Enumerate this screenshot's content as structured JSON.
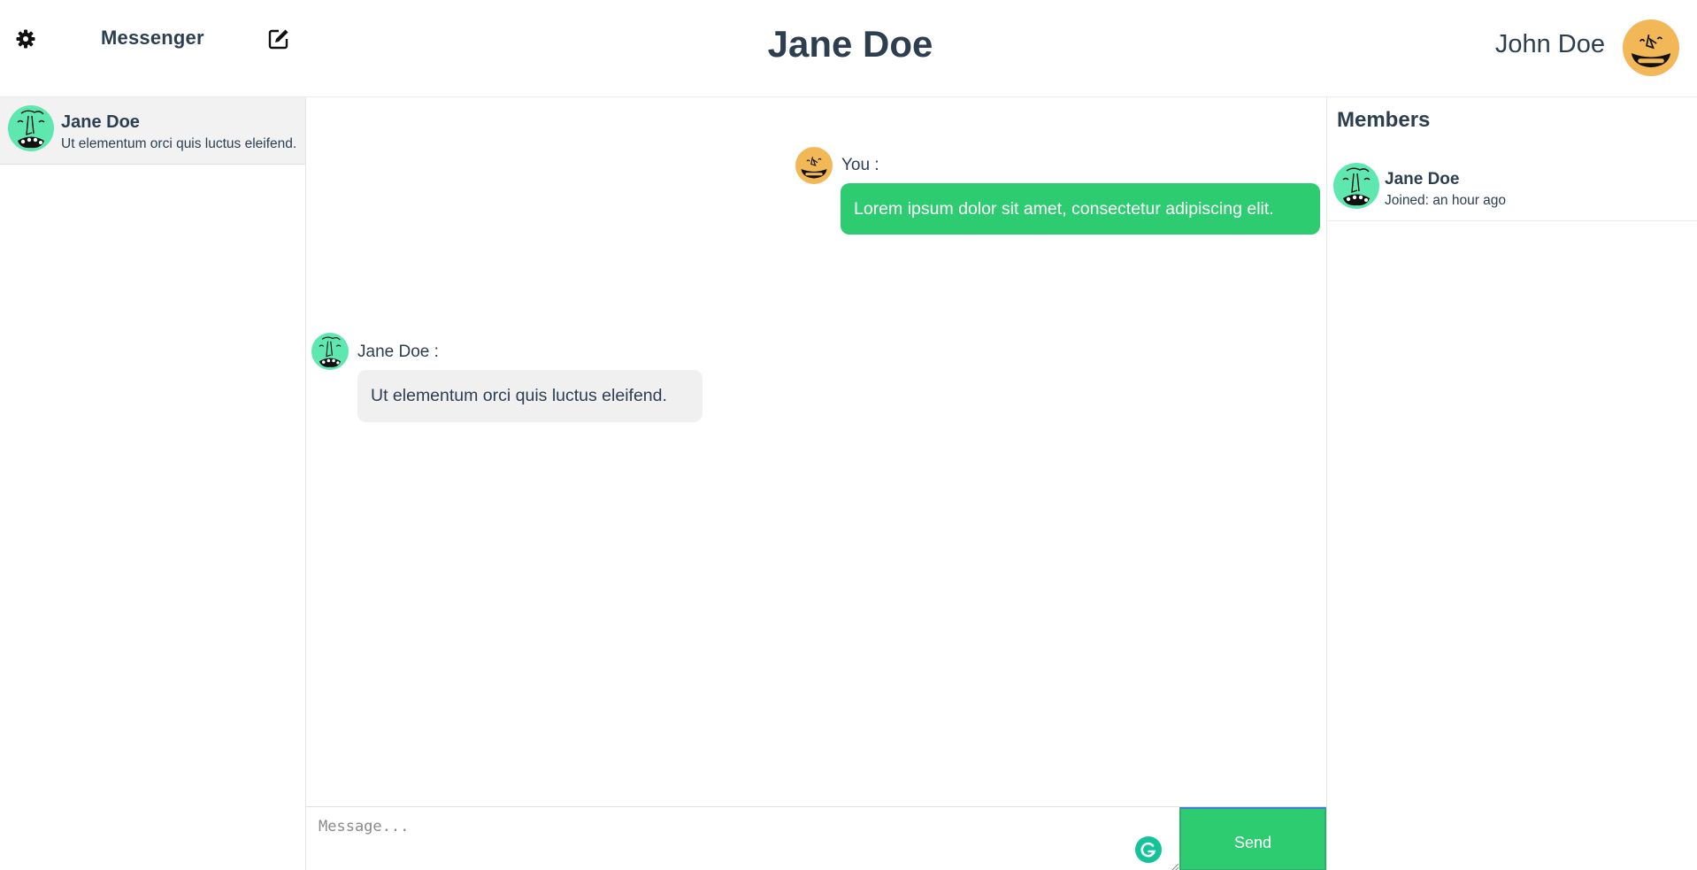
{
  "header": {
    "app_title": "Messenger",
    "chat_title": "Jane Doe",
    "user_name": "John Doe",
    "icons": {
      "settings": "gear-icon",
      "compose": "compose-icon"
    }
  },
  "sidebar": {
    "conversations": [
      {
        "name": "Jane Doe",
        "preview": "Ut elementum orci quis luctus eleifend.",
        "selected": true
      }
    ]
  },
  "messages": [
    {
      "sender": "You :",
      "text": "Lorem ipsum dolor sit amet, consectetur adipiscing elit.",
      "direction": "outgoing"
    },
    {
      "sender": "Jane Doe :",
      "text": "Ut elementum orci quis luctus eleifend.",
      "direction": "incoming"
    }
  ],
  "composer": {
    "placeholder": "Message...",
    "value": "",
    "send_label": "Send"
  },
  "members": {
    "title": "Members",
    "list": [
      {
        "name": "Jane Doe",
        "joined": "Joined: an hour ago"
      }
    ]
  },
  "colors": {
    "accent": "#2ecc71",
    "text": "#2c3e50",
    "avatar_green": "#5ee8b0",
    "avatar_orange": "#f2b756",
    "incoming_bubble": "#f0f0f0",
    "selected_row": "#f2f2f2"
  }
}
